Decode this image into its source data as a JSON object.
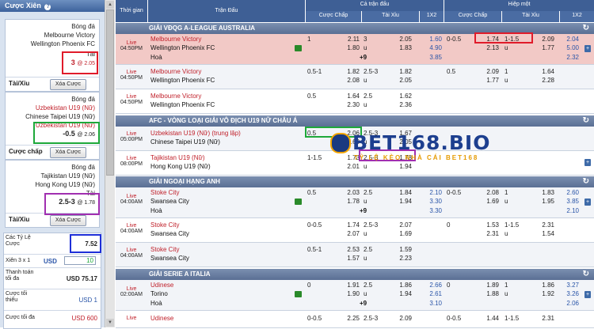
{
  "left": {
    "title": "Cược Xiên",
    "help": "?",
    "slips": [
      {
        "sport": "Bóng đá",
        "home": "Melbourne Victory",
        "away": "Wellington Phoenix FC",
        "market": "Tài",
        "pick": "3",
        "odds": "@ 2.05",
        "bet_type": "Tài/Xỉu",
        "remove": "Xóa Cược"
      },
      {
        "sport": "Bóng đá",
        "home": "Uzbekistan U19 (Nữ)",
        "away": "Chinese Taipei U19 (Nữ)",
        "market": "Uzbekistan U19 (Nữ)",
        "pick": "-0.5",
        "odds": "@ 2.06",
        "bet_type": "Cược chấp",
        "remove": "Xóa Cược"
      },
      {
        "sport": "Bóng đá",
        "home": "Tajikistan U19 (Nữ)",
        "away": "Hong Kong U19 (Nữ)",
        "market": "Tài",
        "pick": "2.5-3",
        "odds": "@ 1.78",
        "bet_type": "Tài/Xỉu",
        "remove": "Xóa Cược"
      }
    ],
    "stats": {
      "odds_label": "Các Tỷ Lệ Cược",
      "odds_value": "7.52",
      "parlay_label": "Xiên 3 x 1",
      "currency": "USD",
      "stake": "10",
      "payout_label": "Thanh toán tối đa",
      "payout_value": "USD 75.17",
      "min_label": "Cược tối thiểu",
      "min_value": "USD 1",
      "max_label": "Cược tối đa",
      "max_value": "USD 600"
    }
  },
  "header": {
    "time": "Thời gian",
    "match": "Trận Đấu",
    "full": "Cả trận đấu",
    "half": "Hiệp một",
    "handicap": "Cược Chấp",
    "ou": "Tài Xỉu",
    "x12": "1X2",
    "handicap2": "Cược Chấp",
    "ou2": "Tài Xỉu",
    "x122": "1X2"
  },
  "leagues": [
    {
      "name": "GIẢI VĐQG A-LEAGUE AUSTRALIA"
    },
    {
      "name": "AFC - VÒNG LOẠI GIẢI VÔ ĐỊCH U19 NỮ CHÂU Á"
    },
    {
      "name": "GIẢI NGOẠI HẠNG ANH"
    },
    {
      "name": "GIẢI SERIE A ITALIA"
    }
  ],
  "rows": [
    {
      "live": "Live",
      "time": "04:50PM",
      "home": "Melbourne Victory",
      "away": "Wellington Phoenix FC",
      "draw": "Hoà",
      "hc": "1",
      "hc_h": "2.11",
      "hc_a": "1.80",
      "ou": "3",
      "ou_u": "u",
      "ou_o": "2.05",
      "ou_oa": "1.83",
      "x1": "1.60",
      "x2": "4.90",
      "xd": "3.85",
      "ou_extra": "+9",
      "h_hc": "0-0.5",
      "h_hc_h": "1.74",
      "h_hc_a": "2.13",
      "h_ou": "1-1.5",
      "h_ou_u": "u",
      "h_ou_o": "2.09",
      "h_ou_oa": "1.77",
      "h_x1": "2.04",
      "h_x2": "5.00",
      "h_xd": "2.32"
    },
    {
      "live": "Live",
      "time": "04:50PM",
      "home": "Melbourne Victory",
      "away": "Wellington Phoenix FC",
      "hc": "0.5-1",
      "hc_h": "1.82",
      "hc_a": "2.08",
      "ou": "2.5-3",
      "ou_u": "u",
      "ou_o": "1.82",
      "ou_oa": "2.05",
      "h_hc": "0.5",
      "h_hc_h": "2.09",
      "h_hc_a": "1.77",
      "h_ou": "1",
      "h_ou_u": "u",
      "h_ou_o": "1.64",
      "h_ou_oa": "2.28"
    },
    {
      "live": "Live",
      "time": "04:50PM",
      "home": "Melbourne Victory",
      "away": "Wellington Phoenix FC",
      "hc": "0.5",
      "hc_h": "1.64",
      "hc_a": "2.30",
      "ou": "2.5",
      "ou_u": "u",
      "ou_o": "1.62",
      "ou_oa": "2.36"
    },
    {
      "live": "Live",
      "time": "05:00PM",
      "home": "Uzbekistan U19 (Nữ) (trung lập)",
      "away": "Chinese Taipei U19 (Nữ)",
      "hc": "0.5",
      "hc_h": "2.06",
      "hc_a": "1.68",
      "ou": "2.5-3",
      "ou_u": "u",
      "ou_o": "1.67",
      "ou_oa": "2.05"
    },
    {
      "live": "Live",
      "time": "08:00PM",
      "home": "Tajikistan U19 (Nữ)",
      "away": "Hong Kong U19 (Nữ)",
      "hc": "1-1.5",
      "hc_h": "1.73",
      "hc_a": "2.01",
      "ou": "2.5-3",
      "ou_u": "u",
      "ou_o": "1.78",
      "ou_oa": "1.94"
    },
    {
      "live": "Live",
      "time": "04:00AM",
      "home": "Stoke City",
      "away": "Swansea City",
      "draw": "Hoà",
      "hc": "0.5",
      "hc_h": "2.03",
      "hc_a": "1.78",
      "ou": "2.5",
      "ou_u": "u",
      "ou_o": "1.84",
      "ou_oa": "1.94",
      "x1": "2.10",
      "x2": "3.30",
      "xd": "3.30",
      "ou_extra": "+9",
      "h_hc": "0-0.5",
      "h_hc_h": "2.08",
      "h_hc_a": "1.69",
      "h_ou": "1",
      "h_ou_u": "u",
      "h_ou_o": "1.83",
      "h_ou_oa": "1.95",
      "h_x1": "2.60",
      "h_x2": "3.85",
      "h_xd": "2.10"
    },
    {
      "live": "Live",
      "time": "04:00AM",
      "home": "Stoke City",
      "away": "Swansea City",
      "hc": "0-0.5",
      "hc_h": "1.74",
      "hc_a": "2.07",
      "ou": "2.5-3",
      "ou_u": "u",
      "ou_o": "2.07",
      "ou_oa": "1.69",
      "h_hc": "0",
      "h_hc_h": "1.53",
      "h_hc_a": "2.31",
      "h_ou": "1-1.5",
      "h_ou_u": "u",
      "h_ou_o": "2.31",
      "h_ou_oa": "1.54"
    },
    {
      "live": "Live",
      "time": "04:00AM",
      "home": "Stoke City",
      "away": "Swansea City",
      "hc": "0.5-1",
      "hc_h": "2.53",
      "hc_a": "1.57",
      "ou": "2.5",
      "ou_u": "u",
      "ou_o": "1.59",
      "ou_oa": "2.23"
    },
    {
      "live": "Live",
      "time": "02:00AM",
      "home": "Udinese",
      "away": "Torino",
      "draw": "Hoà",
      "hc": "0",
      "hc_h": "1.91",
      "hc_a": "1.90",
      "ou": "2.5",
      "ou_u": "u",
      "ou_o": "1.86",
      "ou_oa": "1.94",
      "x1": "2.66",
      "x2": "2.61",
      "xd": "3.10",
      "ou_extra": "+9",
      "h_hc": "0",
      "h_hc_h": "1.89",
      "h_hc_a": "1.88",
      "h_ou": "1",
      "h_ou_u": "u",
      "h_ou_o": "1.86",
      "h_ou_oa": "1.92",
      "h_x1": "3.27",
      "h_x2": "3.26",
      "h_xd": "2.06"
    },
    {
      "live": "Live",
      "home": "Udinese",
      "hc": "0-0.5",
      "hc_h": "2.25",
      "ou": "2.5-3",
      "ou_o": "2.09",
      "h_hc": "0-0.5",
      "h_hc_h": "1.44",
      "h_ou": "1-1.5",
      "h_ou_o": "2.31"
    }
  ],
  "logo": {
    "text": "BET168.BIO",
    "tagline": "TỶ LỆ KÈO NHÀ CÁI BET168"
  }
}
